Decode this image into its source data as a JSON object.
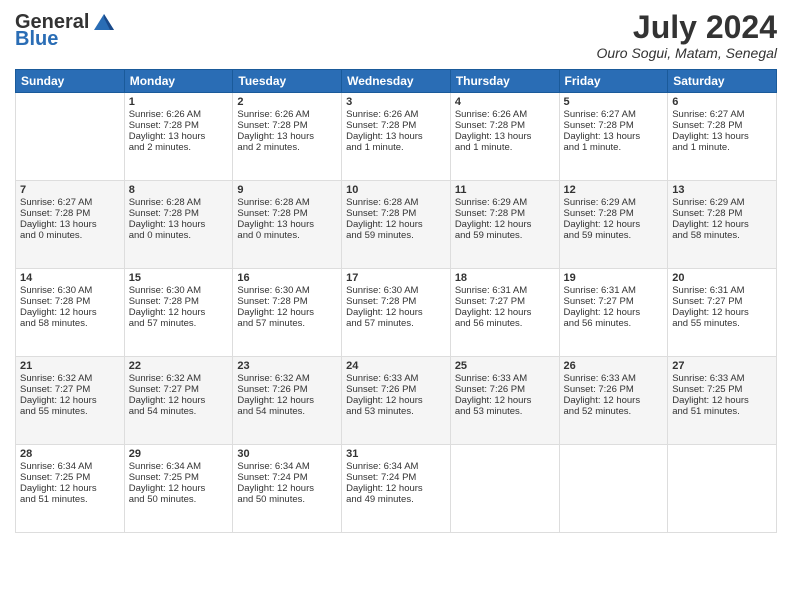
{
  "header": {
    "logo_general": "General",
    "logo_blue": "Blue",
    "month_year": "July 2024",
    "location": "Ouro Sogui, Matam, Senegal"
  },
  "weekdays": [
    "Sunday",
    "Monday",
    "Tuesday",
    "Wednesday",
    "Thursday",
    "Friday",
    "Saturday"
  ],
  "weeks": [
    [
      {
        "day": "",
        "text": ""
      },
      {
        "day": "1",
        "text": "Sunrise: 6:26 AM\nSunset: 7:28 PM\nDaylight: 13 hours\nand 2 minutes."
      },
      {
        "day": "2",
        "text": "Sunrise: 6:26 AM\nSunset: 7:28 PM\nDaylight: 13 hours\nand 2 minutes."
      },
      {
        "day": "3",
        "text": "Sunrise: 6:26 AM\nSunset: 7:28 PM\nDaylight: 13 hours\nand 1 minute."
      },
      {
        "day": "4",
        "text": "Sunrise: 6:26 AM\nSunset: 7:28 PM\nDaylight: 13 hours\nand 1 minute."
      },
      {
        "day": "5",
        "text": "Sunrise: 6:27 AM\nSunset: 7:28 PM\nDaylight: 13 hours\nand 1 minute."
      },
      {
        "day": "6",
        "text": "Sunrise: 6:27 AM\nSunset: 7:28 PM\nDaylight: 13 hours\nand 1 minute."
      }
    ],
    [
      {
        "day": "7",
        "text": "Sunrise: 6:27 AM\nSunset: 7:28 PM\nDaylight: 13 hours\nand 0 minutes."
      },
      {
        "day": "8",
        "text": "Sunrise: 6:28 AM\nSunset: 7:28 PM\nDaylight: 13 hours\nand 0 minutes."
      },
      {
        "day": "9",
        "text": "Sunrise: 6:28 AM\nSunset: 7:28 PM\nDaylight: 13 hours\nand 0 minutes."
      },
      {
        "day": "10",
        "text": "Sunrise: 6:28 AM\nSunset: 7:28 PM\nDaylight: 12 hours\nand 59 minutes."
      },
      {
        "day": "11",
        "text": "Sunrise: 6:29 AM\nSunset: 7:28 PM\nDaylight: 12 hours\nand 59 minutes."
      },
      {
        "day": "12",
        "text": "Sunrise: 6:29 AM\nSunset: 7:28 PM\nDaylight: 12 hours\nand 59 minutes."
      },
      {
        "day": "13",
        "text": "Sunrise: 6:29 AM\nSunset: 7:28 PM\nDaylight: 12 hours\nand 58 minutes."
      }
    ],
    [
      {
        "day": "14",
        "text": "Sunrise: 6:30 AM\nSunset: 7:28 PM\nDaylight: 12 hours\nand 58 minutes."
      },
      {
        "day": "15",
        "text": "Sunrise: 6:30 AM\nSunset: 7:28 PM\nDaylight: 12 hours\nand 57 minutes."
      },
      {
        "day": "16",
        "text": "Sunrise: 6:30 AM\nSunset: 7:28 PM\nDaylight: 12 hours\nand 57 minutes."
      },
      {
        "day": "17",
        "text": "Sunrise: 6:30 AM\nSunset: 7:28 PM\nDaylight: 12 hours\nand 57 minutes."
      },
      {
        "day": "18",
        "text": "Sunrise: 6:31 AM\nSunset: 7:27 PM\nDaylight: 12 hours\nand 56 minutes."
      },
      {
        "day": "19",
        "text": "Sunrise: 6:31 AM\nSunset: 7:27 PM\nDaylight: 12 hours\nand 56 minutes."
      },
      {
        "day": "20",
        "text": "Sunrise: 6:31 AM\nSunset: 7:27 PM\nDaylight: 12 hours\nand 55 minutes."
      }
    ],
    [
      {
        "day": "21",
        "text": "Sunrise: 6:32 AM\nSunset: 7:27 PM\nDaylight: 12 hours\nand 55 minutes."
      },
      {
        "day": "22",
        "text": "Sunrise: 6:32 AM\nSunset: 7:27 PM\nDaylight: 12 hours\nand 54 minutes."
      },
      {
        "day": "23",
        "text": "Sunrise: 6:32 AM\nSunset: 7:26 PM\nDaylight: 12 hours\nand 54 minutes."
      },
      {
        "day": "24",
        "text": "Sunrise: 6:33 AM\nSunset: 7:26 PM\nDaylight: 12 hours\nand 53 minutes."
      },
      {
        "day": "25",
        "text": "Sunrise: 6:33 AM\nSunset: 7:26 PM\nDaylight: 12 hours\nand 53 minutes."
      },
      {
        "day": "26",
        "text": "Sunrise: 6:33 AM\nSunset: 7:26 PM\nDaylight: 12 hours\nand 52 minutes."
      },
      {
        "day": "27",
        "text": "Sunrise: 6:33 AM\nSunset: 7:25 PM\nDaylight: 12 hours\nand 51 minutes."
      }
    ],
    [
      {
        "day": "28",
        "text": "Sunrise: 6:34 AM\nSunset: 7:25 PM\nDaylight: 12 hours\nand 51 minutes."
      },
      {
        "day": "29",
        "text": "Sunrise: 6:34 AM\nSunset: 7:25 PM\nDaylight: 12 hours\nand 50 minutes."
      },
      {
        "day": "30",
        "text": "Sunrise: 6:34 AM\nSunset: 7:24 PM\nDaylight: 12 hours\nand 50 minutes."
      },
      {
        "day": "31",
        "text": "Sunrise: 6:34 AM\nSunset: 7:24 PM\nDaylight: 12 hours\nand 49 minutes."
      },
      {
        "day": "",
        "text": ""
      },
      {
        "day": "",
        "text": ""
      },
      {
        "day": "",
        "text": ""
      }
    ]
  ]
}
